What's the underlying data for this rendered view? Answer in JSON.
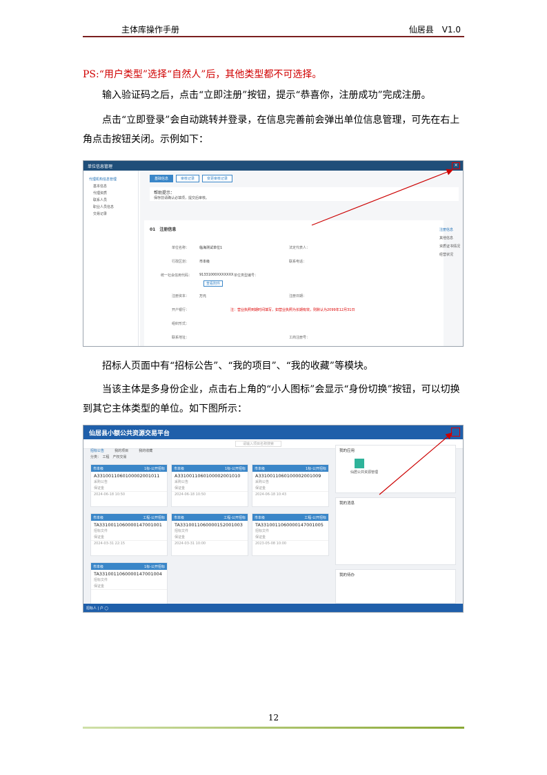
{
  "header": {
    "left": "主体库操作手册",
    "right": "仙居县　V1.0"
  },
  "para_ps": "PS:“用户类型”选择“自然人”后，其他类型都不可选择。",
  "para_1": "输入验证码之后，点击“立即注册”按钮，提示“恭喜你，注册成功”完成注册。",
  "para_2": "点击“立即登录”会自动跳转并登录，在信息完善前会弹出单位信息管理，可先在右上角点击按钮关闭。示例如下：",
  "para_3": "招标人页面中有“招标公告”、“我的项目”、“我的收藏”等模块。",
  "para_4": "当该主体是多身份企业，点击右上角的“小人图标”会显示“身份切换”按钮，可以切换到其它主体类型的单位。如下图所示：",
  "shot1": {
    "title": "单位信息管理",
    "close": "×",
    "side": [
      "代理机构信息管理",
      "基本信息",
      "代理资质",
      "联系人员",
      "职业人员信息",
      "交易记录"
    ],
    "tabs": [
      "基础信息",
      "审核记录",
      "变更审核记录"
    ],
    "notice_title": "帮助提示：",
    "notice_text": "保存前请确认必填项，提交后审核。",
    "section": "01　注册信息",
    "rows": [
      [
        "单位名称：",
        "临海测试单位1",
        "法定代表人："
      ],
      [
        "行政区划：",
        "市本级",
        "联系电话："
      ],
      [
        "统一社会信用代码：",
        "91331000XXXXXXX",
        "单位类型编号："
      ],
      [
        "注册资本：",
        "万元",
        "注册日期："
      ],
      [
        "开户银行：",
        "",
        "工商注册号："
      ],
      [
        "组织形式：",
        "",
        ""
      ],
      [
        "联系地址：",
        "",
        ""
      ]
    ],
    "warn": "注：营业执照到期时间填写，如营业执照为长期有效，则默认为2099年12月31日",
    "btn": "查看附件",
    "right_nav": [
      "注册信息",
      "其他信息",
      "资质证书情况",
      "经营状况"
    ]
  },
  "shot2": {
    "title": "仙居县小额公共资源交易平台",
    "tabs": [
      "招标公告",
      "我的项目",
      "我的收藏"
    ],
    "filter": "分类：　工程　产权交易",
    "search": "请输入项目名称搜索",
    "cards": [
      {
        "area": "市本级",
        "type": "1标-公开招标",
        "code": "A3310011060100002001011",
        "l1": "采购公告",
        "l2": "保证金",
        "date": "2024-06-18 10:50"
      },
      {
        "area": "市本级",
        "type": "1标-公开招标",
        "code": "A3310011060100002001010",
        "l1": "采购公告",
        "l2": "保证金",
        "date": "2024-06-18 10:50"
      },
      {
        "area": "市本级",
        "type": "1标-公开招标",
        "code": "A3310011060100002001009",
        "l1": "采购公告",
        "l2": "保证金",
        "date": "2024-06-18 10:43"
      },
      {
        "area": "市本级",
        "type": "工程-公开招标",
        "code": "TA3310011060000147001001",
        "l1": "招标文件",
        "l2": "保证金",
        "date": "2024-03-31 22:15"
      },
      {
        "area": "市本级",
        "type": "工程-公开招标",
        "code": "TA3310011060000152001003",
        "l1": "招标文件",
        "l2": "保证金",
        "date": "2024-03-31 10:00"
      },
      {
        "area": "市本级",
        "type": "工程-公开招标",
        "code": "TA3310011060000147001005",
        "l1": "招标文件",
        "l2": "保证金",
        "date": "2023-05-08 10:00"
      },
      {
        "area": "市本级",
        "type": "1标-公开招标",
        "code": "TA3310011060000147001004",
        "l1": "招标文件",
        "l2": "保证金",
        "date": ""
      }
    ],
    "panels": [
      "我的应用",
      "我的消息",
      "我的待办"
    ],
    "app_label": "仙居公共资源管理",
    "bottom": "招标人 | 户 ◯"
  },
  "page_number": "12"
}
